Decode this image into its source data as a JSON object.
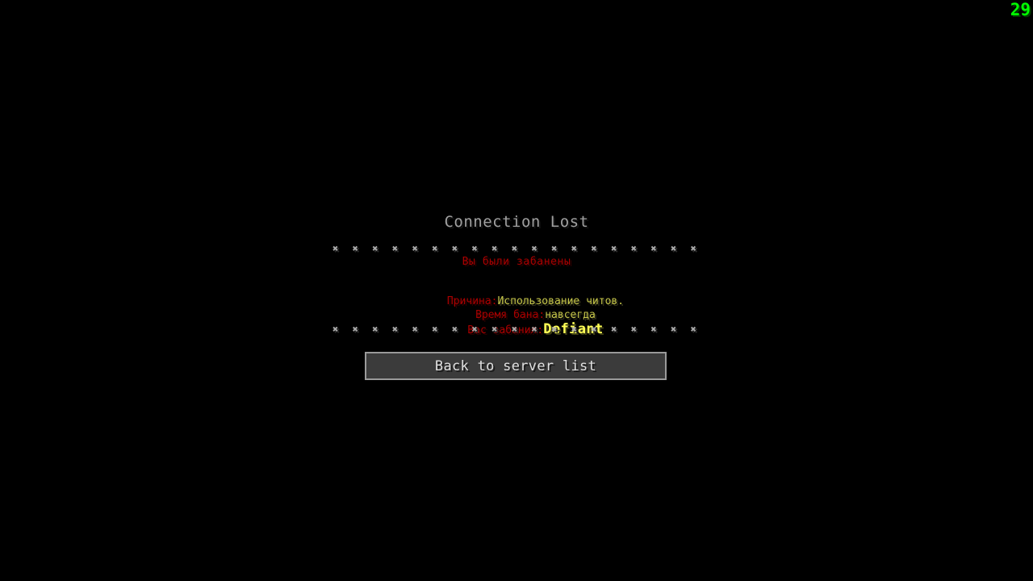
{
  "hud": {
    "fps_counter": "29"
  },
  "disconnect": {
    "title": "Connection Lost",
    "separator_top": "✖ ✖ ✖ ✖ ✖ ✖ ✖ ✖ ✖ ✖ ✖ ✖ ✖ ✖ ✖ ✖ ✖ ✖ ✖",
    "banned_notice": "Вы были забанены",
    "blank": " ",
    "reason_label": "Причина:",
    "reason_value": "Использование читов.",
    "duration_label": "Время бана:",
    "duration_value": "навсегда",
    "banned_by_label": "Вас забанил:",
    "banned_by_value": "Defiant",
    "separator_bottom": "✖ ✖ ✖ ✖ ✖ ✖ ✖ ✖ ✖ ✖ ✖ ✖ ✖ ✖ ✖ ✖ ✖ ✖ ✖",
    "back_button_label": "Back to server list"
  },
  "colors": {
    "background": "#000000",
    "title_gray": "#a0a0a0",
    "separator_gray": "#aaaaaa",
    "dark_red": "#aa0000",
    "muted_yellow": "#c6c64a",
    "bright_yellow": "#ffff55",
    "button_fill": "#3b3b3b",
    "button_border": "#9a9a9a",
    "button_text": "#e0e0e0",
    "fps_green": "#00ff00"
  }
}
